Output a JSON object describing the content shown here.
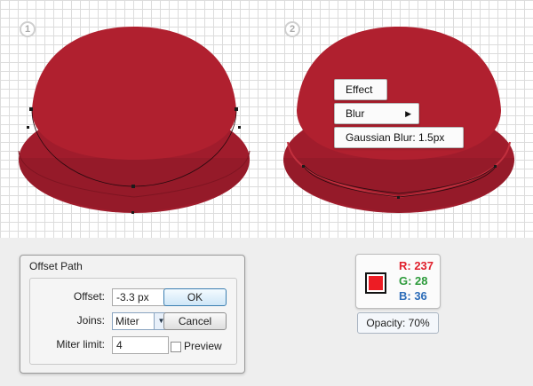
{
  "steps": {
    "step1": "1",
    "step2": "2"
  },
  "colors": {
    "dome": "#b0202f",
    "dome_rim": "#9d1b2a",
    "accent_blue": "#3c7fb1"
  },
  "context_menu": {
    "effect": "Effect",
    "blur": "Blur",
    "gaussian_blur": "Gaussian Blur: 1.5px"
  },
  "offset_path_dialog": {
    "title": "Offset Path",
    "offset_label": "Offset:",
    "offset_value": "-3.3 px",
    "joins_label": "Joins:",
    "joins_value": "Miter",
    "miter_limit_label": "Miter limit:",
    "miter_limit_value": "4",
    "ok_label": "OK",
    "cancel_label": "Cancel",
    "preview_label": "Preview"
  },
  "color_info": {
    "r": "R: 237",
    "g": "G: 28",
    "b": "B: 36",
    "swatch_color": "#ed1c24",
    "r_color": "#e0202c",
    "g_color": "#2c9a3a",
    "b_color": "#2c6cb8",
    "opacity": "Opacity: 70%"
  }
}
